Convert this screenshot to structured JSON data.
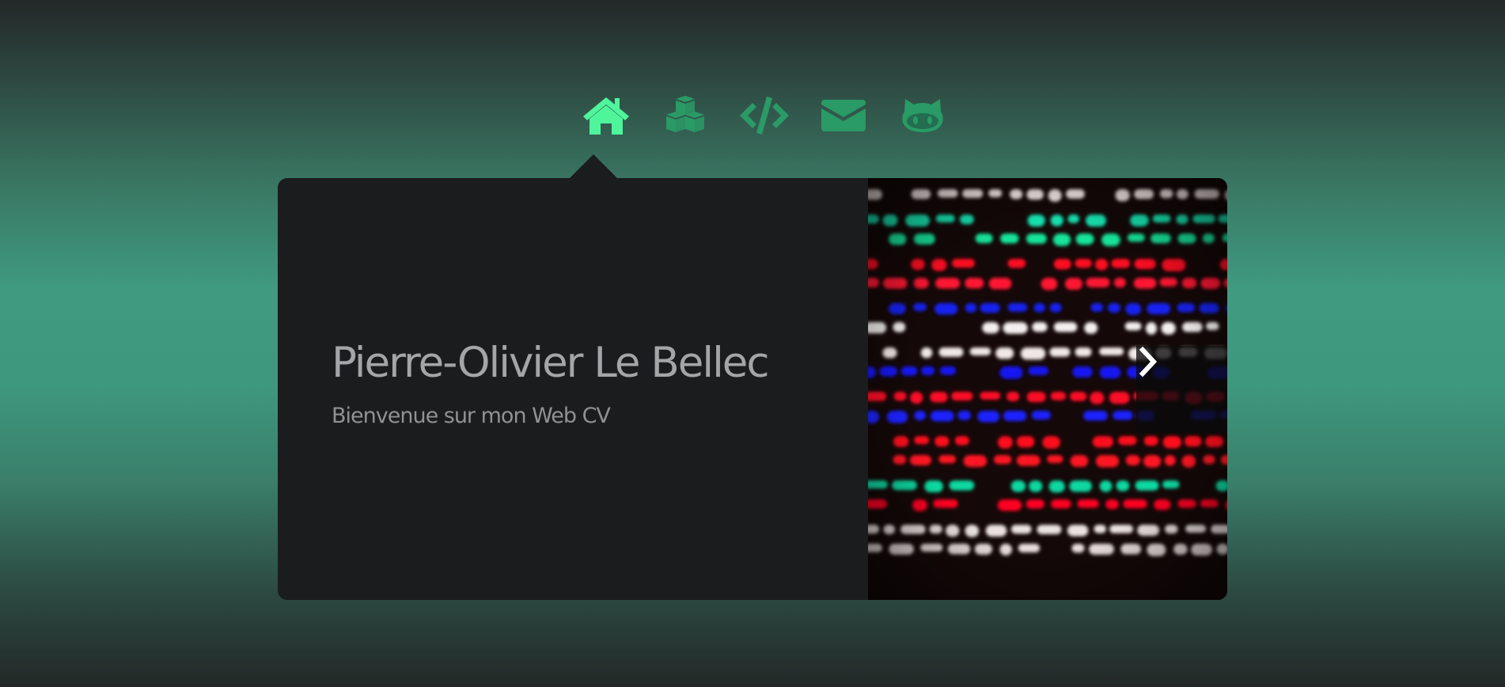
{
  "nav": {
    "items": [
      {
        "name": "home",
        "icon": "home-icon",
        "active": true
      },
      {
        "name": "projects",
        "icon": "cubes-icon",
        "active": false
      },
      {
        "name": "code",
        "icon": "code-icon",
        "active": false
      },
      {
        "name": "contact",
        "icon": "envelope-icon",
        "active": false
      },
      {
        "name": "github",
        "icon": "github-icon",
        "active": false
      }
    ],
    "active_color": "#4ff59b",
    "inactive_color": "#2a9a66"
  },
  "hero": {
    "title": "Pierre-Olivier Le Bellec",
    "subtitle": "Bienvenue sur mon Web CV"
  },
  "slider": {
    "next_icon": "chevron-right-icon",
    "image": "colorful-led-lights"
  },
  "colors": {
    "card_bg": "#1b1c1e",
    "title": "#a3a5a7",
    "subtitle": "#8f9193"
  }
}
